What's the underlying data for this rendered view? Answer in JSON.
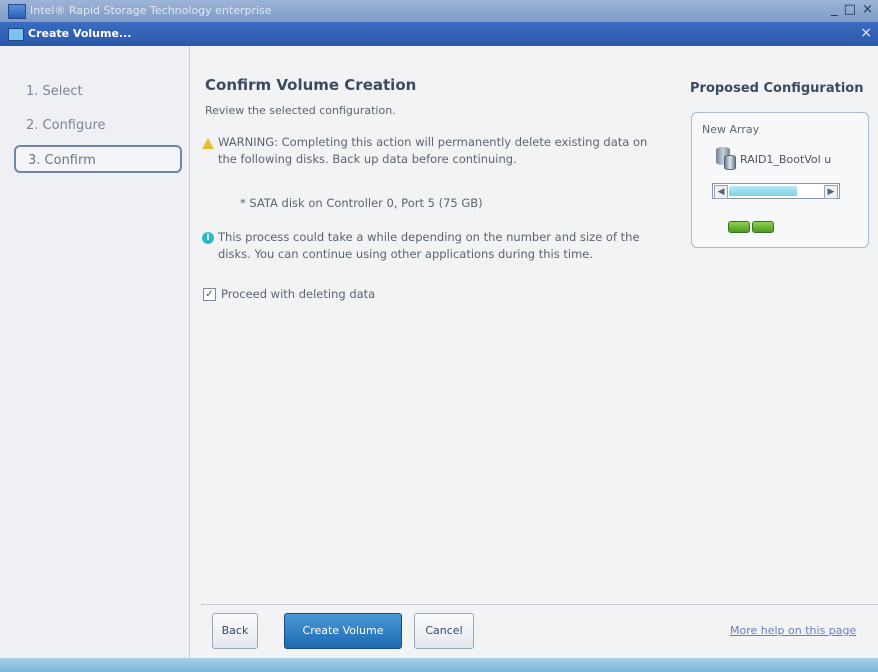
{
  "window": {
    "app_title": "Intel® Rapid Storage Technology enterprise",
    "dialog_title": "Create Volume...",
    "controls": "_ □ ×",
    "close": "×"
  },
  "steps": [
    {
      "label": "1. Select",
      "active": false
    },
    {
      "label": "2. Configure",
      "active": false
    },
    {
      "label": "3. Confirm",
      "active": true
    }
  ],
  "main": {
    "heading": "Confirm Volume Creation",
    "review": "Review the selected configuration.",
    "warning": "WARNING: Completing this action will permanently delete existing data on the following disks. Back up data before continuing.",
    "disk": "* SATA disk on Controller 0, Port 5 (75 GB)",
    "info": "This process could take a while depending on the number and size of the disks. You can continue using other applications during this time.",
    "checkbox_label": "Proceed with deleting data",
    "checkbox_checked": true
  },
  "proposed": {
    "title": "Proposed Configuration",
    "array_label": "New Array",
    "volume_name": "RAID1_BootVol u",
    "volume_fill": 0.72
  },
  "footer": {
    "back": "Back",
    "create": "Create Volume",
    "cancel": "Cancel",
    "help": "More help on this page"
  }
}
